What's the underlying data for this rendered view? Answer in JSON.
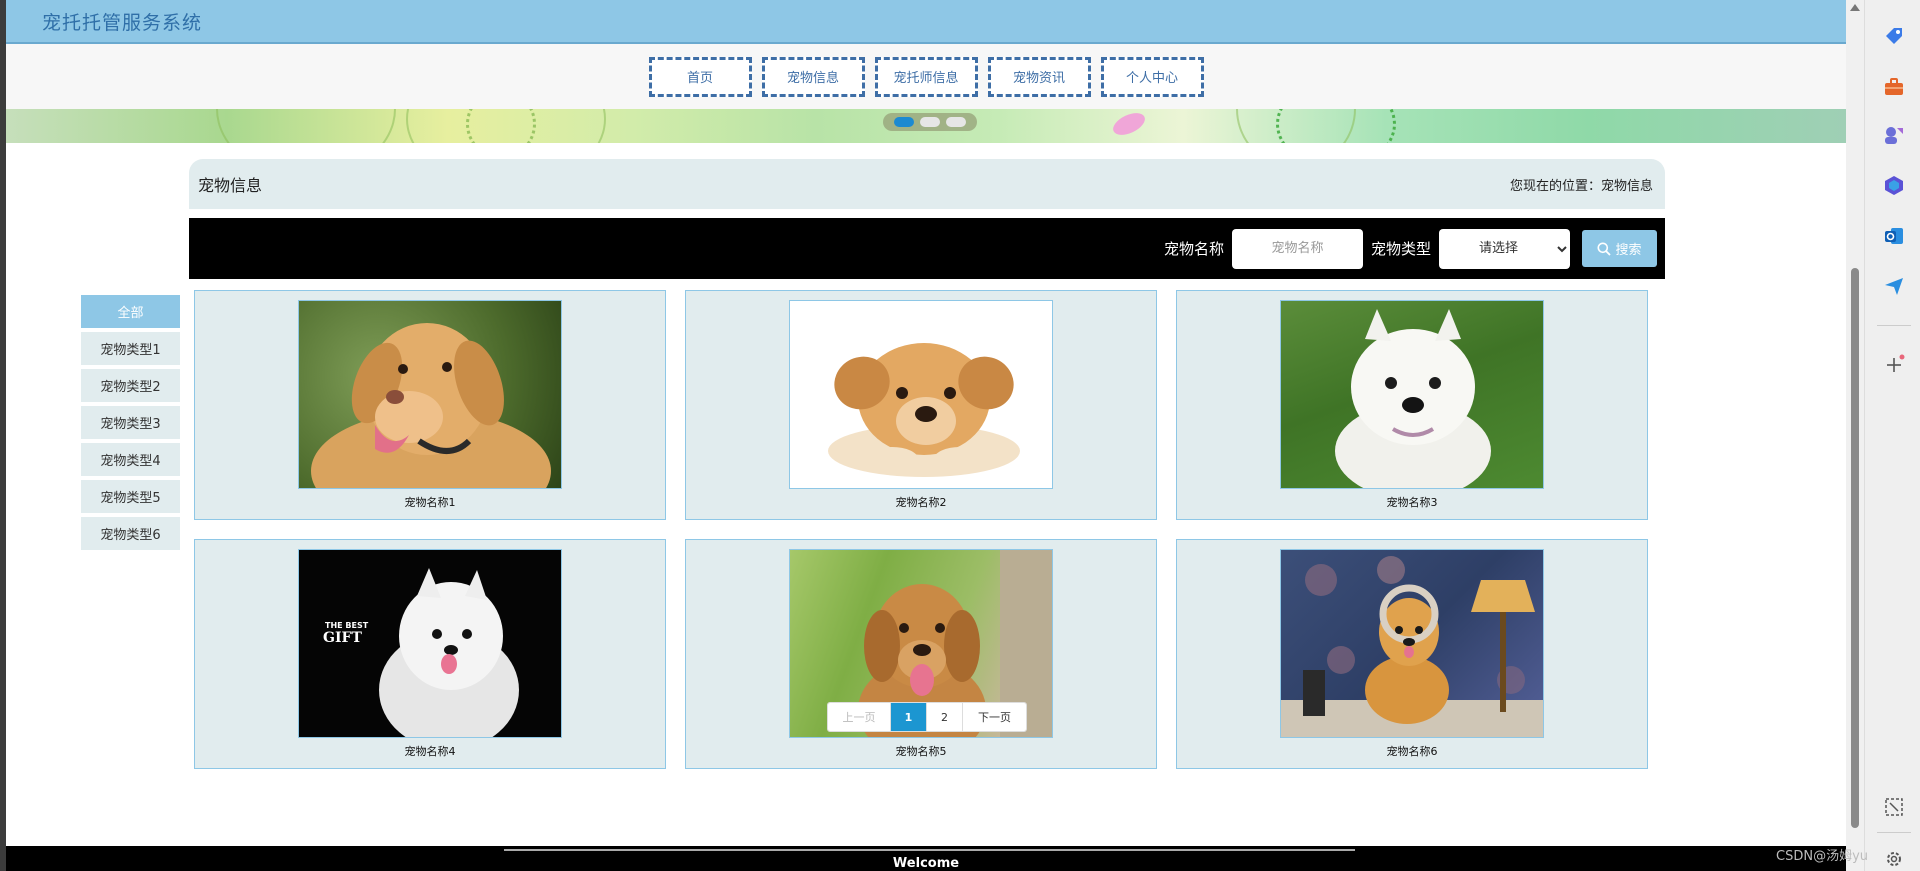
{
  "site": {
    "title": "宠托托管服务系统"
  },
  "nav": {
    "items": [
      {
        "label": "首页"
      },
      {
        "label": "宠物信息"
      },
      {
        "label": "宠托师信息"
      },
      {
        "label": "宠物资讯"
      },
      {
        "label": "个人中心"
      }
    ]
  },
  "banner": {
    "slides": 3,
    "active_slide": 1
  },
  "breadcrumb": {
    "page_title": "宠物信息",
    "location": "您现在的位置：宠物信息"
  },
  "search": {
    "name_label": "宠物名称",
    "name_placeholder": "宠物名称",
    "name_value": "",
    "type_label": "宠物类型",
    "type_selected": "请选择",
    "button_label": "搜索"
  },
  "categories": [
    {
      "label": "全部",
      "active": true
    },
    {
      "label": "宠物类型1"
    },
    {
      "label": "宠物类型2"
    },
    {
      "label": "宠物类型3"
    },
    {
      "label": "宠物类型4"
    },
    {
      "label": "宠物类型5"
    },
    {
      "label": "宠物类型6"
    }
  ],
  "pets": [
    {
      "name": "宠物名称1",
      "image": "golden-retriever-photo"
    },
    {
      "name": "宠物名称2",
      "image": "puppy-lying-photo"
    },
    {
      "name": "宠物名称3",
      "image": "westie-on-grass-photo"
    },
    {
      "name": "宠物名称4",
      "image": "white-pomeranian-photo",
      "caption_art": "THE BEST GIFT"
    },
    {
      "name": "宠物名称5",
      "image": "golden-retriever-grass-photo"
    },
    {
      "name": "宠物名称6",
      "image": "puppy-with-lamp-photo"
    }
  ],
  "pagination": {
    "prev_label": "上一页",
    "pages": [
      "1",
      "2"
    ],
    "current_page": "1",
    "next_label": "下一页"
  },
  "footer": {
    "welcome": "Welcome"
  },
  "watermark": "CSDN@汤姆yu",
  "colors": {
    "topbar": "#8ec7e6",
    "nav_border": "#3e6ea6",
    "accent": "#1c96d1",
    "panel": "#e1ecee",
    "search_bar": "#000000"
  }
}
